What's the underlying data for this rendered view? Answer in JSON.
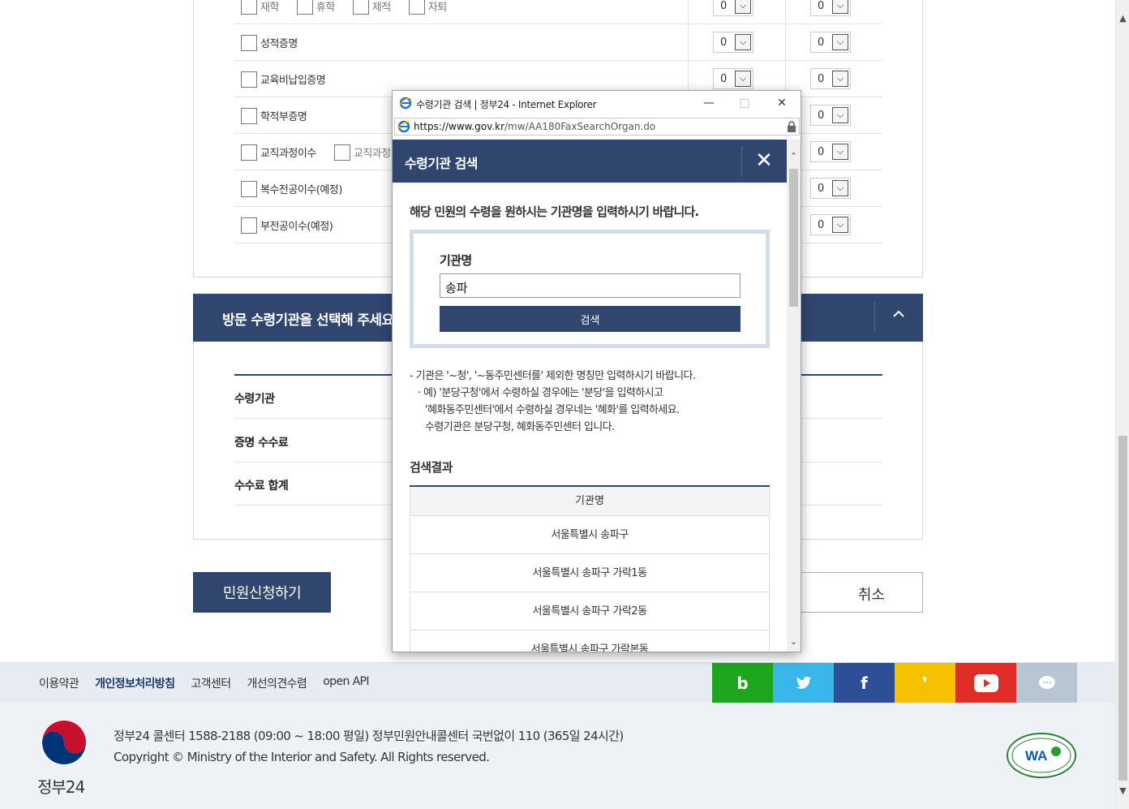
{
  "background": {
    "doc_rows": [
      {
        "items": [
          "재학",
          "휴학",
          "제적",
          "자퇴"
        ],
        "qty1": "0",
        "qty2": "0"
      },
      {
        "items": [
          "성적증명"
        ],
        "qty1": "0",
        "qty2": "0"
      },
      {
        "items": [
          "교육비납입증명"
        ],
        "qty1": "0",
        "qty2": "0"
      },
      {
        "items": [
          "학적부증명"
        ],
        "qty2": "0"
      },
      {
        "items": [
          "교직과정이수",
          "교직과정"
        ],
        "qty2": "0"
      },
      {
        "items": [
          "복수전공이수(예정)"
        ],
        "qty2": "0"
      },
      {
        "items": [
          "부전공이수(예정)"
        ],
        "qty2": "0"
      }
    ],
    "section_title": "방문 수령기관을 선택해 주세요",
    "toggle_icon": "chevron-up-icon",
    "fee_rows": [
      "수령기관",
      "증명 수수료",
      "수수료 합계"
    ],
    "apply_button": "민원신청하기",
    "cancel_button": "취소"
  },
  "footer": {
    "links": [
      "이용약관",
      "개인정보처리방침",
      "고객센터",
      "개선의견수렴",
      "open API"
    ],
    "sns": [
      {
        "name": "blog",
        "glyph": "b",
        "color": "#1ea61e"
      },
      {
        "name": "twitter",
        "glyph": "❖",
        "color": "#39b6ea"
      },
      {
        "name": "facebook",
        "glyph": "f",
        "color": "#2d4f98"
      },
      {
        "name": "kakaostory",
        "glyph": "❜",
        "color": "#f6c200"
      },
      {
        "name": "youtube",
        "glyph": "▶",
        "color": "#e12d27"
      },
      {
        "name": "kakaotalk",
        "glyph": "…",
        "color": "#b8c5d3"
      }
    ],
    "logo_text": "정부24",
    "info_line1": "정부24 콜센터 1588-2188 (09:00 ~ 18:00 평일) 정부민원안내콜센터 국번없이 110 (365일 24시간)",
    "info_line2": "Copyright © Ministry of the Interior and Safety. All Rights reserved."
  },
  "popup": {
    "window_title": "수령기관 검색 | 정부24 - Internet Explorer",
    "url_domain": "https://www.gov.kr",
    "url_path": "/mw/AA180FaxSearchOrgan.do",
    "header_title": "수령기관 검색",
    "guide_text": "해당 민원의 수령을 원하시는 기관명을 입력하시기 바랍니다.",
    "field_label": "기관명",
    "field_value": "송파",
    "search_button": "검색",
    "notes": [
      "- 기관은 '~청', '~동주민센터를' 제외한 명칭만 입력하시기 바랍니다.",
      "· 예) '분당구청'에서 수령하실 경우에는 '분당'을 입력하시고",
      "'혜화동주민센터'에서 수령하실 경우네는 '혜화'를 입력하세요.",
      "수령기관은 분당구청, 혜화동주민센터 입니다."
    ],
    "results_title": "검색결과",
    "results_header": "기관명",
    "results": [
      "서울특별시 송파구",
      "서울특별시 송파구 가락1동",
      "서울특별시 송파구 가락2동",
      "서울특별시 송파구 가락본동"
    ]
  }
}
